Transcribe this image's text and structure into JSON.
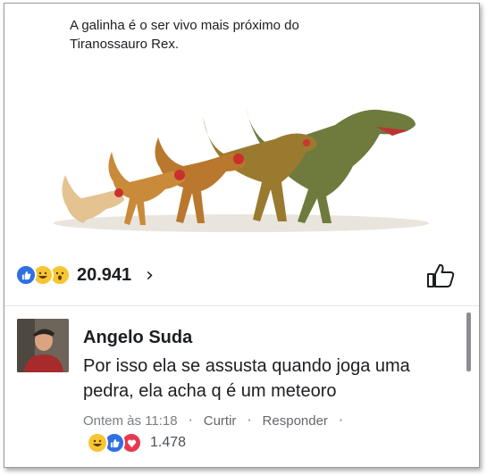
{
  "post": {
    "text": "A galinha é o ser vivo mais próximo do Tiranossauro Rex.",
    "reactions": {
      "icons": [
        "like-icon",
        "haha-icon",
        "wow-icon"
      ],
      "count": "20.941",
      "chevron": "›"
    }
  },
  "comment": {
    "author": "Angelo Suda",
    "text": "Por isso ela se assusta quando joga uma pedra, ela acha q é um meteoro",
    "time": "Ontem às 11:18",
    "like_action": "Curtir",
    "reply_action": "Responder",
    "separator": "·",
    "reactions": {
      "icons": [
        "haha-icon",
        "like-icon",
        "love-icon"
      ],
      "count": "1.478"
    }
  },
  "colors": {
    "like_blue": "#2f6fe4",
    "haha_yellow": "#f7c531",
    "love_red": "#e83a4f",
    "meta_gray": "#7a7d82"
  }
}
